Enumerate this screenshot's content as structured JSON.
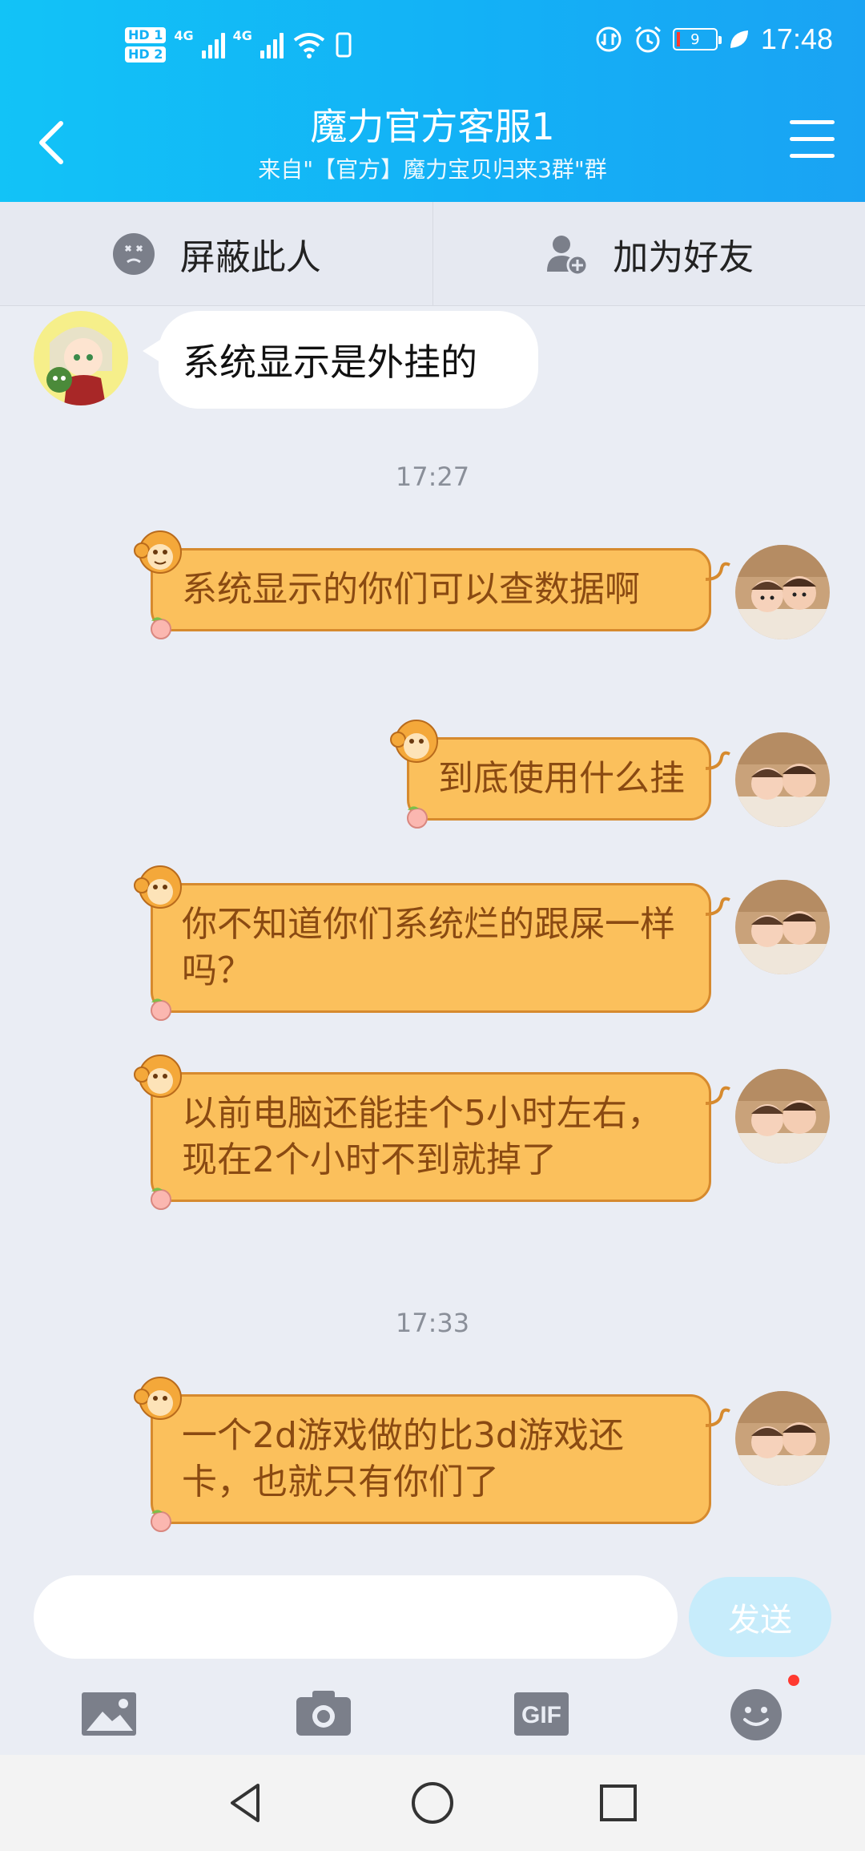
{
  "status_bar": {
    "time": "17:48",
    "battery": "9",
    "sim1_label": "HD 1",
    "sim2_label": "HD 2",
    "net1": "4G",
    "net2": "4G",
    "icons": [
      "signal-icon",
      "wifi-icon",
      "data-saver-icon",
      "alarm-icon",
      "battery-icon",
      "leaf-icon"
    ]
  },
  "header": {
    "title": "魔力官方客服1",
    "subtitle": "来自\"【官方】魔力宝贝归来3群\"群"
  },
  "actions": {
    "block_label": "屏蔽此人",
    "add_friend_label": "加为好友"
  },
  "messages": [
    {
      "side": "left",
      "text": "系统显示是外挂的"
    },
    {
      "type": "timestamp",
      "text": "17:27"
    },
    {
      "side": "right",
      "text": "系统显示的你们可以查数据啊"
    },
    {
      "side": "right",
      "text": "到底使用什么挂"
    },
    {
      "side": "right",
      "text": "你不知道你们系统烂的跟屎一样吗？"
    },
    {
      "side": "right",
      "text": "以前电脑还能挂个5小时左右，现在2个小时不到就掉了"
    },
    {
      "type": "timestamp",
      "text": "17:33"
    },
    {
      "side": "right",
      "text": "一个2d游戏做的比3d游戏还卡，也就只有你们了"
    }
  ],
  "input": {
    "placeholder": "",
    "send_label": "发送"
  },
  "colors": {
    "header_blue": "#13b1f6",
    "bubble_orange": "#fbc05c",
    "bubble_text": "#8a4a12"
  }
}
